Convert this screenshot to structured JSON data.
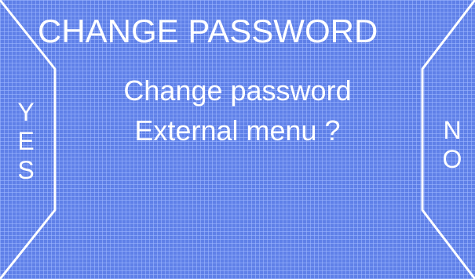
{
  "screen": {
    "title": "CHANGE PASSWORD",
    "message_line1": "Change password",
    "message_line2": "External menu ?"
  },
  "yes_button": {
    "letters": [
      "Y",
      "E",
      "S"
    ]
  },
  "no_button": {
    "letters": [
      "N",
      "O"
    ]
  },
  "colors": {
    "background": "#5f80e8",
    "grid": "#a0b9ff",
    "text": "#ffffff",
    "frame_lines": "#ffffff"
  }
}
